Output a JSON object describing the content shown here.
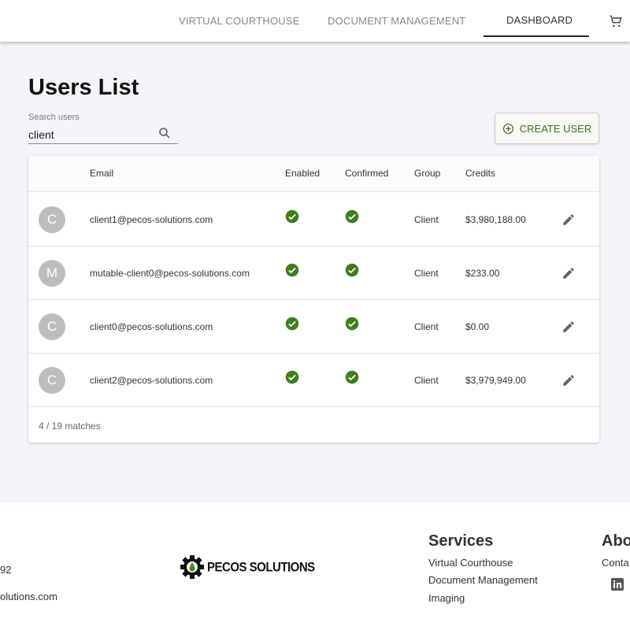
{
  "nav": {
    "items": [
      {
        "label": "VIRTUAL COURTHOUSE"
      },
      {
        "label": "DOCUMENT MANAGEMENT"
      },
      {
        "label": "DASHBOARD",
        "active": true
      }
    ],
    "cart_icon": "shopping-cart-icon"
  },
  "page": {
    "title": "Users List"
  },
  "search": {
    "label": "Search users",
    "value": "client",
    "icon": "search-icon"
  },
  "create_button": {
    "label": "CREATE USER",
    "icon": "add-circle-icon",
    "color": "#3f6e22"
  },
  "table": {
    "columns": [
      "Email",
      "Enabled",
      "Confirmed",
      "Group",
      "Credits"
    ],
    "rows": [
      {
        "initial": "C",
        "email": "client1@pecos-solutions.com",
        "enabled": true,
        "confirmed": true,
        "group": "Client",
        "credits": "$3,980,188.00"
      },
      {
        "initial": "M",
        "email": "mutable-client0@pecos-solutions.com",
        "enabled": true,
        "confirmed": true,
        "group": "Client",
        "credits": "$233.00"
      },
      {
        "initial": "C",
        "email": "client0@pecos-solutions.com",
        "enabled": true,
        "confirmed": true,
        "group": "Client",
        "credits": "$0.00"
      },
      {
        "initial": "C",
        "email": "client2@pecos-solutions.com",
        "enabled": true,
        "confirmed": true,
        "group": "Client",
        "credits": "$3,979,949.00"
      }
    ],
    "footer": "4 / 19 matches",
    "check_color": "#3f7d1e"
  },
  "footer": {
    "left": [
      "92",
      "olutions.com"
    ],
    "logo_text": "PECOS SOLUTIONS",
    "services": {
      "heading": "Services",
      "links": [
        "Virtual Courthouse",
        "Document Management",
        "Imaging"
      ]
    },
    "about": {
      "heading": "Abo",
      "links": [
        "Conta"
      ],
      "icon": "linkedin-icon"
    }
  }
}
